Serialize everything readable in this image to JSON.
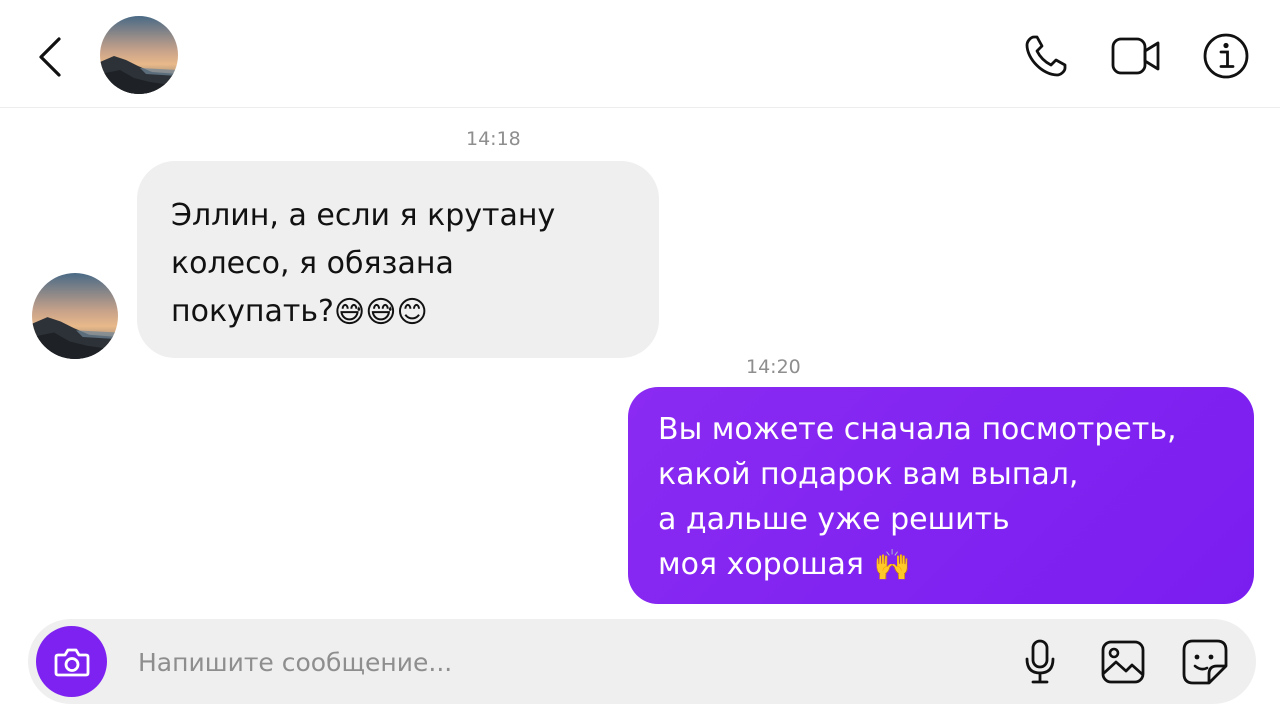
{
  "conversation": {
    "messages": [
      {
        "timestamp": "14:18",
        "direction": "incoming",
        "text": "Эллин, а если я крутану\nколесо, я обязана\nпокупать?",
        "trailing_emojis": [
          "😅",
          "😅",
          "😊"
        ]
      },
      {
        "timestamp": "14:20",
        "direction": "outgoing",
        "text": "Вы можете сначала посмотреть,\nкакой подарок вам выпал,\nа дальше уже решить\nмоя хорошая",
        "trailing_emojis": [
          "🙌"
        ]
      }
    ]
  },
  "composer": {
    "placeholder": "Напишите сообщение...",
    "value": ""
  },
  "icons": {
    "back": "chevron-left-icon",
    "call": "phone-icon",
    "video": "video-camera-icon",
    "info": "info-icon",
    "camera": "camera-icon",
    "mic": "microphone-icon",
    "gallery": "image-icon",
    "sticker": "sticker-icon"
  },
  "colors": {
    "accent": "#7d22f0",
    "incoming_bubble": "#efefef",
    "outgoing_bubble": "#8a2bf2",
    "timestamp": "#8e8e8e"
  }
}
